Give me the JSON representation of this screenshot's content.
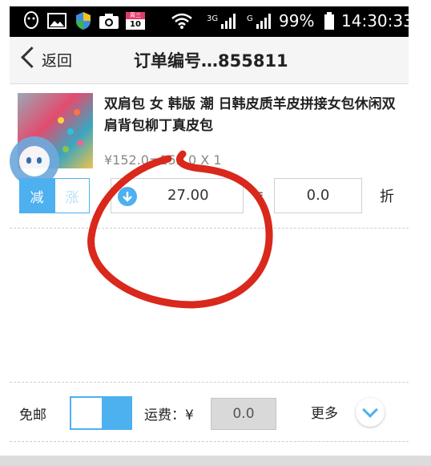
{
  "status_bar": {
    "signal_3g": "3G",
    "signal_g": "G",
    "battery_percent": "99%",
    "time": "14:30:33",
    "calendar_day": "10",
    "calendar_week": "周三"
  },
  "header": {
    "back_label": "返回",
    "title": "订单编号…855811"
  },
  "product": {
    "name": "双肩包 女 韩版 潮 日韩皮质羊皮拼接女包休闲双肩背包柳丁真皮包",
    "price_line": "¥152.0=152.0 X 1"
  },
  "adjust": {
    "decrease_label": "减",
    "increase_label": "涨",
    "selected": "减",
    "amount": "27.00",
    "equals": "=",
    "discount_rate": "0.0",
    "discount_unit": "折"
  },
  "shipping": {
    "free_ship_label": "免邮",
    "free_ship_on": true,
    "freight_label": "运费：¥",
    "freight_value": "0.0",
    "more_label": "更多"
  },
  "colors": {
    "accent": "#4db0ef",
    "annotation": "#d9281c"
  },
  "icons": [
    "qq-icon",
    "image-icon",
    "shield-icon",
    "camera-icon",
    "calendar-icon",
    "wifi-icon",
    "signal-icon",
    "battery-icon",
    "back-chevron-icon",
    "down-arrow-icon",
    "chevron-down-icon",
    "floating-bubble-icon"
  ]
}
